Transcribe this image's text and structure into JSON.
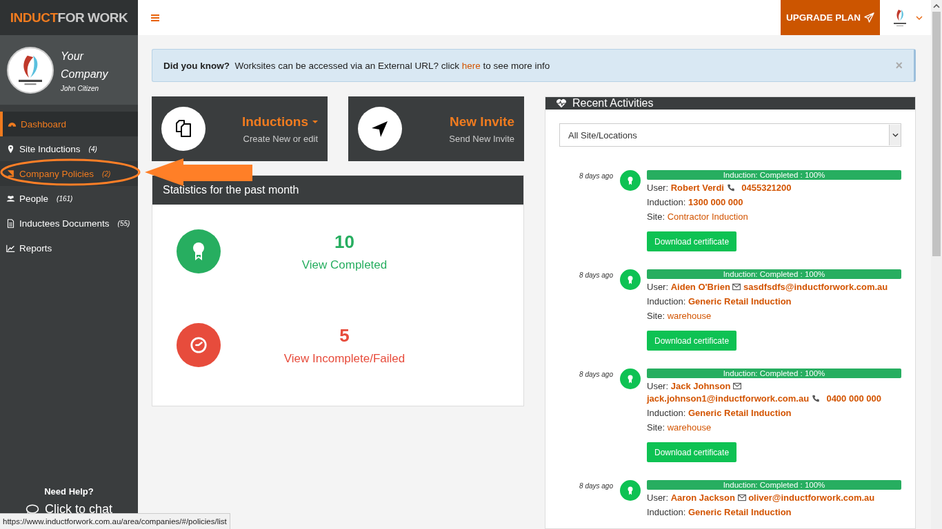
{
  "brand": {
    "primary": "INDUCT",
    "secondary": "FOR WORK"
  },
  "profile": {
    "company": "Your Company",
    "user": "John Citizen"
  },
  "sidebar": {
    "items": [
      {
        "label": "Dashboard",
        "selected": true,
        "hovered": false
      },
      {
        "label": "Site Inductions",
        "count": "(4)",
        "selected": false,
        "hovered": false
      },
      {
        "label": "Company Policies",
        "count": "(2)",
        "selected": false,
        "hovered": true
      },
      {
        "label": "People",
        "count": "(161)",
        "selected": false,
        "hovered": false
      },
      {
        "label": "Inductees Documents",
        "count": "(55)",
        "selected": false,
        "hovered": false
      },
      {
        "label": "Reports",
        "selected": false,
        "hovered": false
      }
    ],
    "help_title": "Need Help?",
    "chat_link": "Click to chat"
  },
  "topbar": {
    "upgrade_button": "UPGRADE PLAN"
  },
  "alert": {
    "text": "**Did you know?**  Worksites can be accessed via an External URL? click",
    "link": "here",
    "text_after": "to see more info",
    "close": "×"
  },
  "action_cards": [
    {
      "title": "Inductions",
      "dropdown": true,
      "subtitle": "Create New or edit"
    },
    {
      "title": "New Invite",
      "dropdown": false,
      "subtitle": "Send New Invite"
    }
  ],
  "statistics": {
    "title": "Statistics for the past month",
    "items": [
      {
        "value": "10",
        "link": "View Completed",
        "color": "#27ae60"
      },
      {
        "value": "5",
        "link": "View Incomplete/Failed",
        "color": "#e74c3c"
      }
    ]
  },
  "recent_activities": {
    "title": "Recent Activities",
    "filter": "All Site/Locations",
    "items": [
      {
        "time": "8 days ago",
        "status": "Induction: Completed : 100%",
        "level": 1,
        "user_label": "User:",
        "user": "Robert Verdi",
        "phone": "0455321200",
        "induction_label": "Induction:",
        "induction": "1300 000 000",
        "site_label": "Site:",
        "site": "Contractor Induction",
        "button": "Download certificate"
      },
      {
        "time": "8 days ago",
        "status": "Induction: Completed : 100%",
        "level": 1,
        "user_label": "User:",
        "user": "Aiden O'Brien",
        "email": "sasdfsdfs@inductforwork.com.au",
        "induction_label": "Induction:",
        "induction": "Generic Retail Induction",
        "site_label": "Site:",
        "site": "warehouse",
        "button": "Download certificate"
      },
      {
        "time": "8 days ago",
        "status": "Induction: Completed : 100%",
        "level": 1,
        "user_label": "User:",
        "user": "Jack Johnson",
        "email": "jack.johnson1@inductforwork.com.au",
        "phone": "0400 000 000",
        "induction_label": "Induction:",
        "induction": "Generic Retail Induction",
        "site_label": "Site:",
        "site": "warehouse",
        "button": "Download certificate"
      },
      {
        "time": "8 days ago",
        "status": "Induction: Completed : 100%",
        "level": 1,
        "user_label": "User:",
        "user": "Aaron Jackson",
        "email": "oliver@inductforwork.com.au",
        "induction_label": "Induction:",
        "induction": "Generic Retail Induction"
      }
    ]
  },
  "status_url": "https://www.inductforwork.com.au/area/companies/#/policies/list"
}
